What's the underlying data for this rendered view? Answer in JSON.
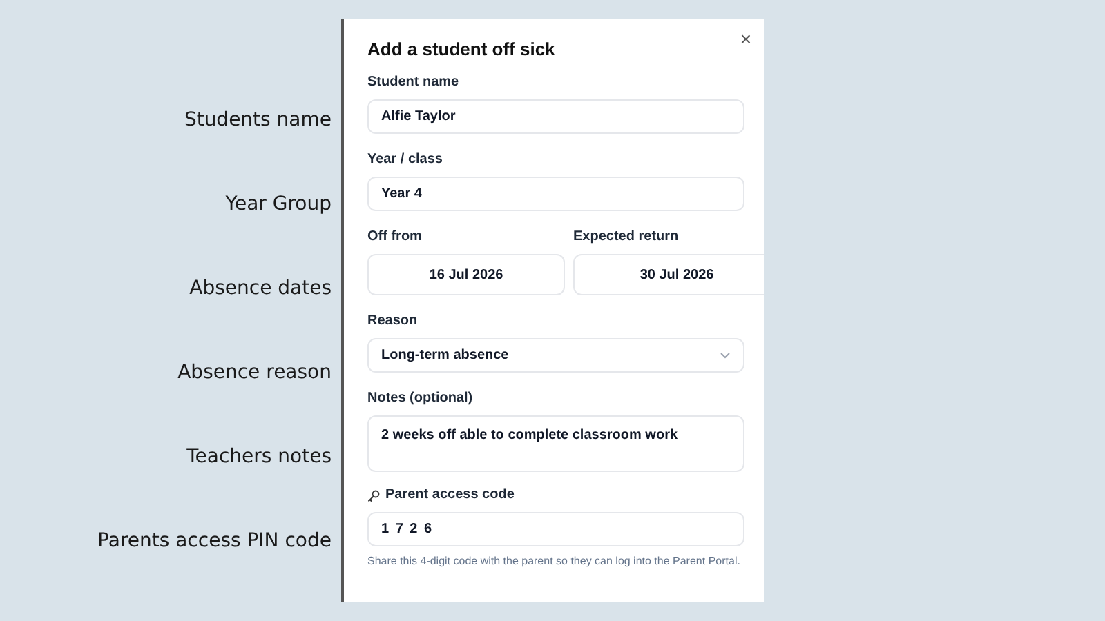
{
  "annotations": [
    "Students name",
    "Year Group",
    "Absence dates",
    "Absence reason",
    "Teachers notes",
    "Parents access PIN code"
  ],
  "dialog": {
    "title": "Add a student off sick",
    "close": "×",
    "fields": [
      {
        "kind": "text",
        "label": "Student name",
        "value": "Alfie Taylor"
      },
      {
        "kind": "text",
        "label": "Year / class",
        "value": "Year 4"
      },
      {
        "kind": "dates",
        "items": [
          {
            "label": "Off from",
            "value": "16 Jul 2026"
          },
          {
            "label": "Expected return",
            "value": "30 Jul 2026"
          }
        ]
      },
      {
        "kind": "select",
        "label": "Reason",
        "value": "Long-term absence"
      },
      {
        "kind": "textarea",
        "label": "Notes (optional)",
        "value": "2 weeks off able to complete classroom work"
      },
      {
        "kind": "code",
        "label": "Parent access code",
        "value": "1 7 2 6",
        "hint": "Share this 4-digit code with the parent so they can log into the Parent Portal."
      }
    ]
  }
}
